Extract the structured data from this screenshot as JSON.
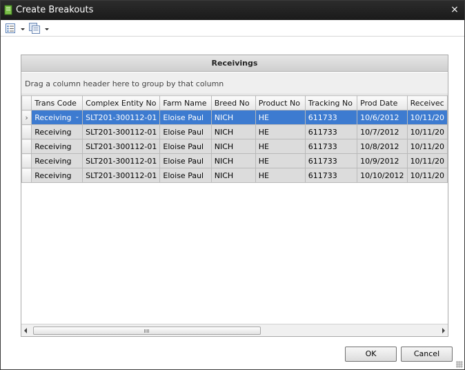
{
  "window": {
    "title": "Create Breakouts",
    "close_label": "×"
  },
  "grid": {
    "title": "Receivings",
    "group_hint": "Drag a column header here to group by that column",
    "columns": {
      "trans_code": "Trans Code",
      "complex_entity_no": "Complex Entity No",
      "farm_name": "Farm Name",
      "breed_no": "Breed No",
      "product_no": "Product No",
      "tracking_no": "Tracking No",
      "prod_date": "Prod Date",
      "received": "Receivec"
    },
    "rows": [
      {
        "trans_code": "Receiving",
        "complex_entity_no": "SLT201-300112-01",
        "farm_name": "Eloise Paul",
        "breed_no": "NICH",
        "product_no": "HE",
        "tracking_no": "611733",
        "prod_date": "10/6/2012",
        "received": "10/11/20"
      },
      {
        "trans_code": "Receiving",
        "complex_entity_no": "SLT201-300112-01",
        "farm_name": "Eloise Paul",
        "breed_no": "NICH",
        "product_no": "HE",
        "tracking_no": "611733",
        "prod_date": "10/7/2012",
        "received": "10/11/20"
      },
      {
        "trans_code": "Receiving",
        "complex_entity_no": "SLT201-300112-01",
        "farm_name": "Eloise Paul",
        "breed_no": "NICH",
        "product_no": "HE",
        "tracking_no": "611733",
        "prod_date": "10/8/2012",
        "received": "10/11/20"
      },
      {
        "trans_code": "Receiving",
        "complex_entity_no": "SLT201-300112-01",
        "farm_name": "Eloise Paul",
        "breed_no": "NICH",
        "product_no": "HE",
        "tracking_no": "611733",
        "prod_date": "10/9/2012",
        "received": "10/11/20"
      },
      {
        "trans_code": "Receiving",
        "complex_entity_no": "SLT201-300112-01",
        "farm_name": "Eloise Paul",
        "breed_no": "NICH",
        "product_no": "HE",
        "tracking_no": "611733",
        "prod_date": "10/10/2012",
        "received": "10/11/20"
      }
    ],
    "selected_row_indicator": "›"
  },
  "buttons": {
    "ok": "OK",
    "cancel": "Cancel"
  },
  "colors": {
    "titlebar": "#1f1f1f",
    "selection": "#3d7bd0",
    "row_background": "#dcdcdc"
  },
  "icons": {
    "app": "document-green-icon",
    "toolbar_1": "list-options-icon",
    "toolbar_2": "layout-icon"
  }
}
